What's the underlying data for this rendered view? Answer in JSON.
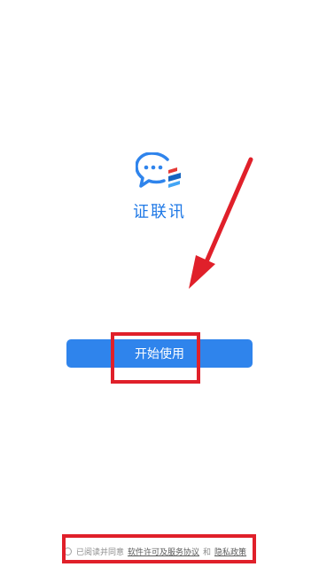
{
  "app": {
    "name": "证联讯",
    "logo_icon": "chat-bubble-logo-icon"
  },
  "main": {
    "start_button_label": "开始使用"
  },
  "agreement": {
    "prefix": "已阅读并同意",
    "license_link": "软件许可及服务协议",
    "conjunction": "和",
    "privacy_link": "隐私政策"
  },
  "colors": {
    "accent": "#2f84ec",
    "title": "#1e78e6",
    "annotation": "#e0202a"
  }
}
